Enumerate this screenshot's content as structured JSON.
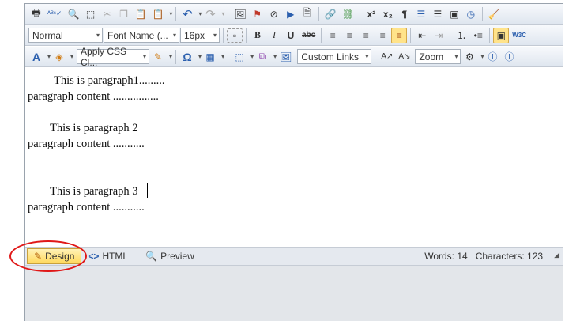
{
  "toolbar1": {
    "print_icon": "🖶",
    "spell_icon": "ᴬᴮᶜ✓",
    "find_icon": "🔍",
    "select_all_icon": "⬚",
    "cut_icon": "✂",
    "copy_icon": "❐",
    "paste_icon": "📋",
    "paste_special_icon": "📋",
    "undo_icon": "↶",
    "redo_icon": "↷",
    "image_icon": "🖼",
    "flash_icon": "⚑",
    "media_icon": "⊘",
    "play_icon": "▶",
    "document_icon": "🗎",
    "link_icon": "🔗",
    "unlink_icon": "⛓",
    "superscript_label": "x²",
    "subscript_label": "x₂",
    "paragraph_icon": "¶",
    "template_icon": "☰",
    "align_icon": "☰",
    "form_icon": "▣",
    "clock_icon": "◷",
    "clean_icon": "🧹"
  },
  "toolbar2": {
    "paragraph_style": "Normal",
    "font_name": "Font Name (...",
    "font_size": "16px",
    "insert_image_icon": "▫",
    "bold_label": "B",
    "italic_label": "I",
    "underline_label": "U",
    "strike_label": "abc",
    "w3c_label": "W3C"
  },
  "toolbar3": {
    "font_color_label": "A",
    "css_class": "Apply CSS Cl...",
    "omega_label": "Ω",
    "custom_links": "Custom Links",
    "zoom": "Zoom"
  },
  "content": {
    "lines": [
      "This is paragraph1.........",
      "paragraph content ................",
      "This is paragraph 2",
      "paragraph content ...........",
      "This is paragraph 3",
      "paragraph content ..........."
    ]
  },
  "footer": {
    "tabs": [
      {
        "label": "Design",
        "icon": "✎"
      },
      {
        "label": "HTML",
        "icon": "<>"
      },
      {
        "label": "Preview",
        "icon": "🔍"
      }
    ],
    "words": "Words: 14",
    "characters": "Characters: 123"
  },
  "colors": {
    "accent": "#ffd95c",
    "highlight_ring": "#e01818"
  }
}
